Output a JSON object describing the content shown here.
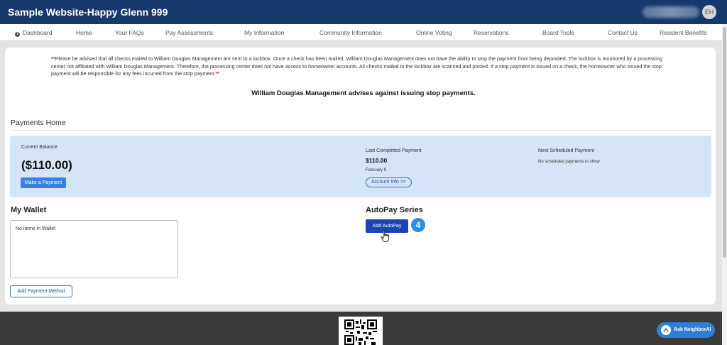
{
  "header": {
    "site_title": "Sample Website-Happy Glenn 999",
    "avatar_initials": "EH"
  },
  "nav": {
    "items": [
      {
        "label": "Dashboard"
      },
      {
        "label": "Home"
      },
      {
        "label": "Your FAQs"
      },
      {
        "label": "Pay Assessments"
      },
      {
        "label": "My Information"
      },
      {
        "label": "Community Information"
      },
      {
        "label": "Online Voting"
      },
      {
        "label": "Reservations"
      },
      {
        "label": "Board Tools"
      },
      {
        "label": "Contact Us"
      },
      {
        "label": "Resident Benefits"
      }
    ]
  },
  "notice": {
    "star": "**",
    "text": "Please be advised that all checks mailed to William Douglas Management are sent to a lockbox. Once a check has been mailed, William Douglas Management does not have the ability to stop the payment from being deposited. The lockbox is monitored by a processing center not affiliated with William Douglas Management. Therefore, the processing center does not have access to homeowner accounts. All checks mailed to the lockbox are scanned and posted. If a stop payment is issued on a check, the homeowner who issued the stop payment will be responsible for any fees incurred from the stop payment.",
    "advise": "William Douglas Management advises against issuing stop payments."
  },
  "payments": {
    "section_title": "Payments Home",
    "current_balance_label": "Current Balance",
    "current_balance": "($110.00)",
    "make_payment_label": "Make a Payment",
    "last_completed_label": "Last Completed Payment",
    "last_completed_amount": "$110.00",
    "last_completed_date": "February 9",
    "account_info_label": "Account Info >>",
    "next_scheduled_label": "Next Scheduled Payment",
    "next_scheduled_text": "No scheduled payments to show"
  },
  "wallet": {
    "title": "My Wallet",
    "empty_text": "No items in Wallet",
    "add_method_label": "Add Payment Method"
  },
  "autopay": {
    "title": "AutoPay Series",
    "add_label": "Add AutoPay",
    "step_number": "4"
  },
  "footer": {
    "ask_label": "Ask NeighborAI"
  },
  "colors": {
    "header_bg": "#16386b",
    "panel_bg": "#d6e4f7",
    "primary_button": "#1b46b2",
    "step_badge": "#2b8fe3"
  }
}
